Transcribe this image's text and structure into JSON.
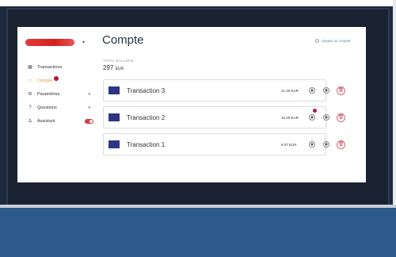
{
  "sidebar": {
    "items": [
      {
        "label": "Transactions",
        "icon": "grid-icon"
      },
      {
        "label": "Compte",
        "icon": "wallet-icon",
        "active": true
      },
      {
        "label": "Paramètres",
        "icon": "gear-icon"
      },
      {
        "label": "Questions",
        "icon": "help-icon"
      },
      {
        "label": "Assistant",
        "icon": "assistant-icon"
      }
    ]
  },
  "header": {
    "title": "Compte",
    "add_account_label": "Ajouter un compte"
  },
  "balance": {
    "label": "TOTAL BALANCE",
    "value": "297",
    "currency": "EUR"
  },
  "transactions": [
    {
      "name": "Transaction 3",
      "amount": "21.30 EUR"
    },
    {
      "name": "Transaction 2",
      "amount": "15.29 EUR"
    },
    {
      "name": "Transaction 1",
      "amount": "6.07 EUR"
    }
  ],
  "colors": {
    "accent": "#e0a030",
    "swatch": "#2d3585",
    "danger": "#c94a60",
    "toggle": "#d93a4a"
  }
}
